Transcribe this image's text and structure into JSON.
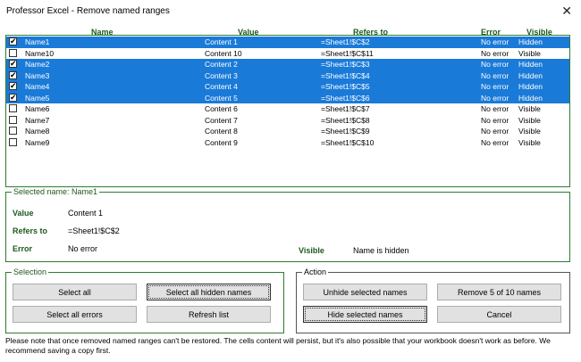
{
  "window": {
    "title": "Professor Excel - Remove named ranges",
    "close_glyph": "✕"
  },
  "columns": {
    "name": "Name",
    "value": "Value",
    "refers_to": "Refers to",
    "error": "Error",
    "visible": "Visible"
  },
  "rows": [
    {
      "checked": true,
      "selected": true,
      "name": "Name1",
      "value": "Content 1",
      "refers_to": "=Sheet1!$C$2",
      "error": "No error",
      "visible": "Hidden"
    },
    {
      "checked": false,
      "selected": false,
      "name": "Name10",
      "value": "Content 10",
      "refers_to": "=Sheet1!$C$11",
      "error": "No error",
      "visible": "Visible"
    },
    {
      "checked": true,
      "selected": true,
      "name": "Name2",
      "value": "Content 2",
      "refers_to": "=Sheet1!$C$3",
      "error": "No error",
      "visible": "Hidden"
    },
    {
      "checked": true,
      "selected": true,
      "name": "Name3",
      "value": "Content 3",
      "refers_to": "=Sheet1!$C$4",
      "error": "No error",
      "visible": "Hidden"
    },
    {
      "checked": true,
      "selected": true,
      "name": "Name4",
      "value": "Content 4",
      "refers_to": "=Sheet1!$C$5",
      "error": "No error",
      "visible": "Hidden"
    },
    {
      "checked": true,
      "selected": true,
      "name": "Name5",
      "value": "Content 5",
      "refers_to": "=Sheet1!$C$6",
      "error": "No error",
      "visible": "Hidden"
    },
    {
      "checked": false,
      "selected": false,
      "name": "Name6",
      "value": "Content 6",
      "refers_to": "=Sheet1!$C$7",
      "error": "No error",
      "visible": "Visible"
    },
    {
      "checked": false,
      "selected": false,
      "name": "Name7",
      "value": "Content 7",
      "refers_to": "=Sheet1!$C$8",
      "error": "No error",
      "visible": "Visible"
    },
    {
      "checked": false,
      "selected": false,
      "name": "Name8",
      "value": "Content 8",
      "refers_to": "=Sheet1!$C$9",
      "error": "No error",
      "visible": "Visible"
    },
    {
      "checked": false,
      "selected": false,
      "name": "Name9",
      "value": "Content 9",
      "refers_to": "=Sheet1!$C$10",
      "error": "No error",
      "visible": "Visible"
    }
  ],
  "details": {
    "legend": "Selected name: Name1",
    "value_label": "Value",
    "value": "Content 1",
    "refers_label": "Refers to",
    "refers": "=Sheet1!$C$2",
    "error_label": "Error",
    "error": "No error",
    "visible_label": "Visible",
    "visible": "Name is hidden"
  },
  "selection": {
    "legend": "Selection",
    "select_all": "Select all",
    "select_hidden": "Select all hidden names",
    "select_errors": "Select all errors",
    "refresh": "Refresh list"
  },
  "action": {
    "legend": "Action",
    "unhide": "Unhide selected names",
    "remove": "Remove 5 of 10 names",
    "hide": "Hide selected names",
    "cancel": "Cancel"
  },
  "note": "Please note that once removed named ranges can't be restored. The cells content will persist, but it's also possible that your workbook doesn't work as before. We recommend saving a copy first.",
  "colors": {
    "selection": "#1a7ad8",
    "header_green": "#1d5a1d",
    "border_green": "#2e7d32"
  }
}
